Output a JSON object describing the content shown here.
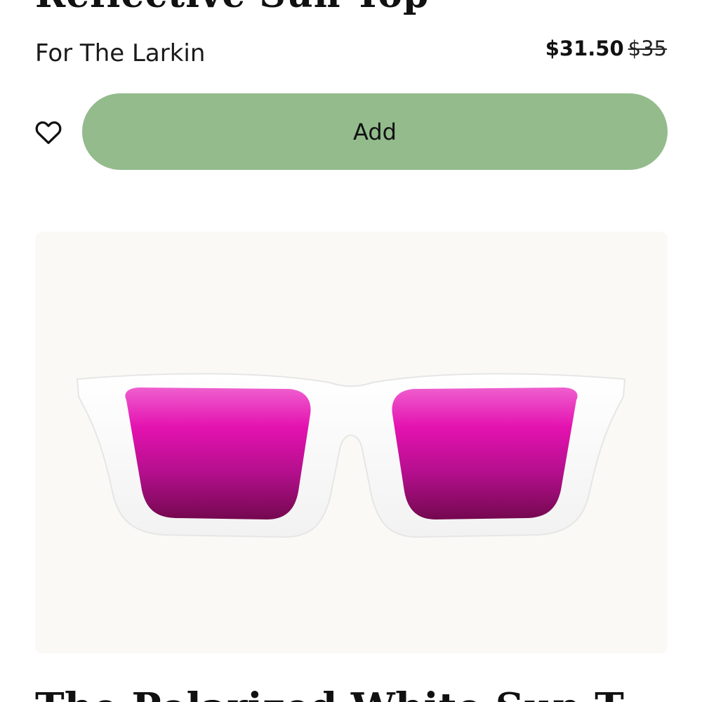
{
  "current_product": {
    "title": "Reflective Sun Top",
    "brand": "For The Larkin",
    "sale_price": "$31.50",
    "original_price": "$35",
    "add_label": "Add",
    "wishlist_icon": "heart-outline-icon",
    "add_button_color": "#93bb8c"
  },
  "next_product": {
    "image_icon": "sunglasses-white-frame-pink-lens",
    "image_background": "#faf9f5",
    "lens_colors": [
      "#e628b8",
      "#7a0a5a"
    ],
    "title": "The Polarized White Sun T"
  }
}
